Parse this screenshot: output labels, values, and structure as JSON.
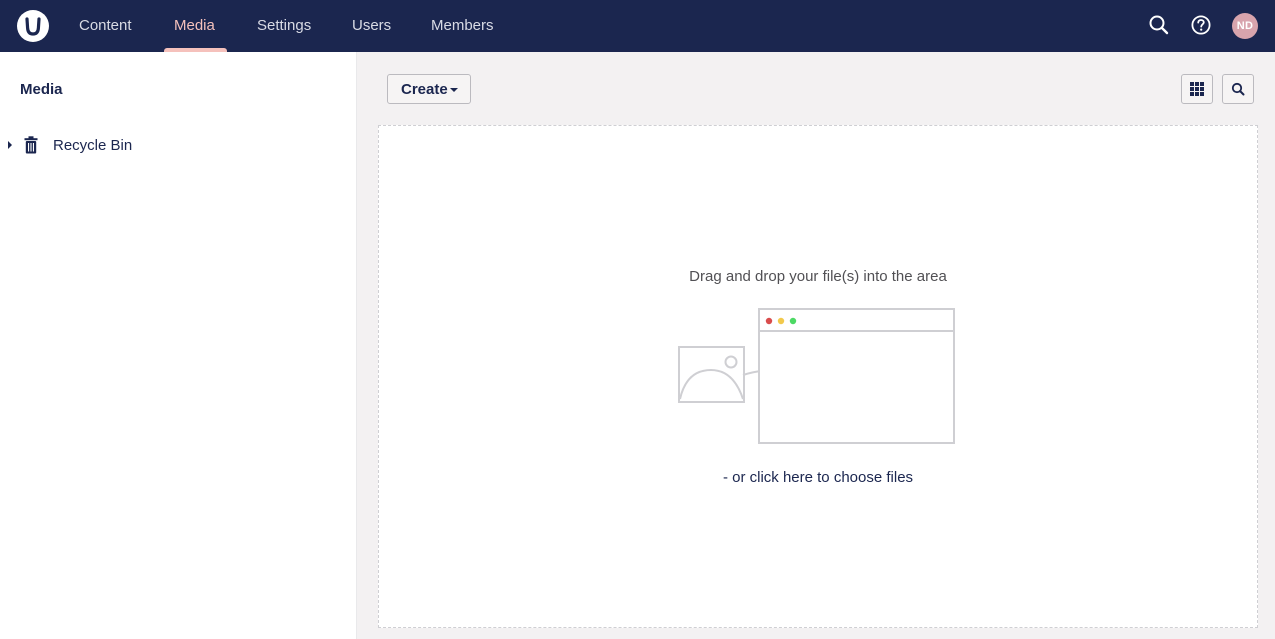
{
  "header": {
    "nav": [
      {
        "label": "Content"
      },
      {
        "label": "Media"
      },
      {
        "label": "Settings"
      },
      {
        "label": "Users"
      },
      {
        "label": "Members"
      }
    ],
    "active_nav": "Media",
    "avatar_initials": "ND",
    "icons": [
      "search-icon",
      "help-icon"
    ]
  },
  "sidebar": {
    "title": "Media",
    "items": [
      {
        "label": "Recycle Bin",
        "icon": "trash-icon"
      }
    ]
  },
  "toolbar": {
    "create_label": "Create",
    "buttons": [
      "grid-view-icon",
      "search-icon"
    ]
  },
  "dropzone": {
    "instruction": "Drag and drop your file(s) into the area",
    "choose_link": "- or click here to choose files"
  },
  "colors": {
    "header_bg": "#1b264f",
    "accent": "#f5c1bc",
    "page_bg": "#f3f1f2",
    "avatar_bg": "#d8a4ad"
  }
}
